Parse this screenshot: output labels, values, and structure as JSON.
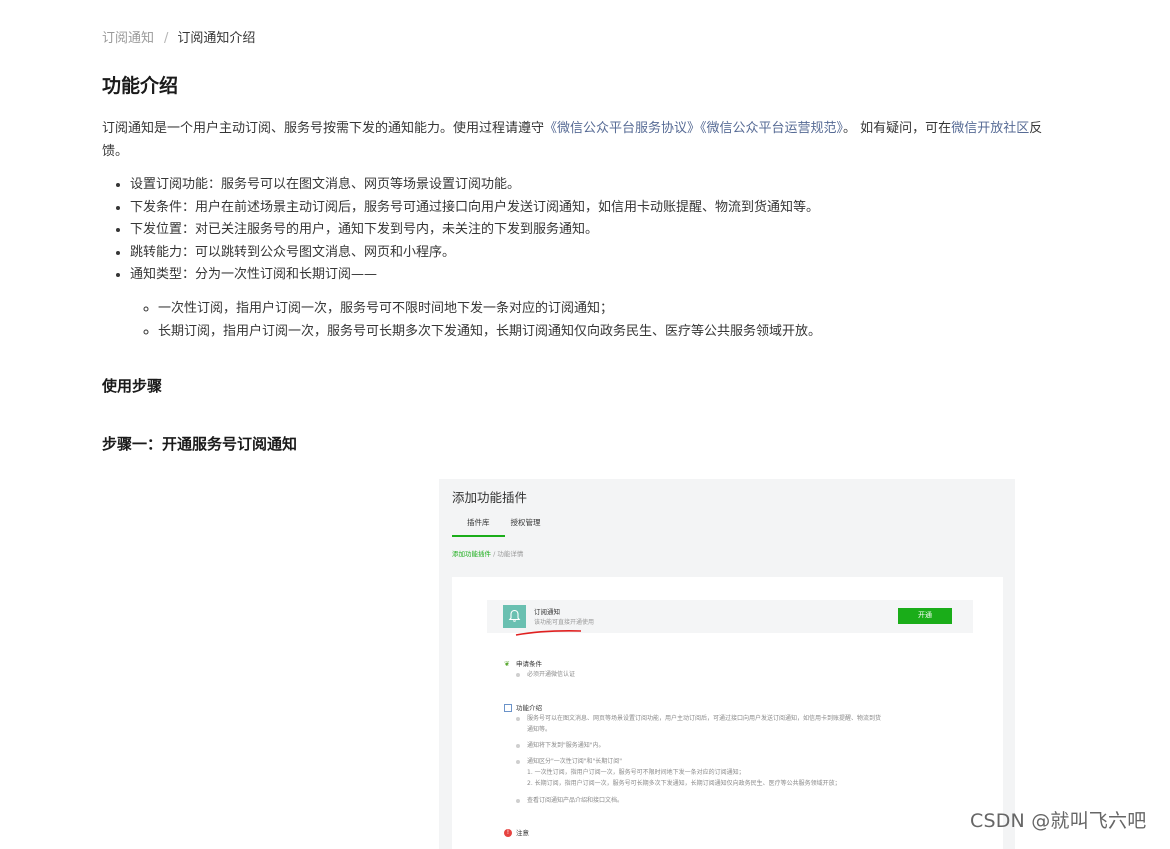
{
  "breadcrumb": {
    "parent": "订阅通知",
    "separator": "/",
    "current": "订阅通知介绍"
  },
  "title": "功能介绍",
  "intro": {
    "text1": "订阅通知是一个用户主动订阅、服务号按需下发的通知能力。使用过程请遵守",
    "link1": "《微信公众平台服务协议》",
    "link2": "《微信公众平台运营规范》",
    "text2": "。 如有疑问，可在",
    "link3": "微信开放社区",
    "text3": "反馈。"
  },
  "features": [
    "设置订阅功能：服务号可以在图文消息、网页等场景设置订阅功能。",
    "下发条件：用户在前述场景主动订阅后，服务号可通过接口向用户发送订阅通知，如信用卡动账提醒、物流到货通知等。",
    "下发位置：对已关注服务号的用户，通知下发到号内，未关注的下发到服务通知。",
    "跳转能力：可以跳转到公众号图文消息、网页和小程序。",
    "通知类型：分为一次性订阅和长期订阅——"
  ],
  "sub_features": [
    "一次性订阅，指用户订阅一次，服务号可不限时间地下发一条对应的订阅通知；",
    "长期订阅，指用户订阅一次，服务号可长期多次下发通知，长期订阅通知仅向政务民生、医疗等公共服务领域开放。"
  ],
  "usage_title": "使用步骤",
  "step1_title": "步骤一：开通服务号订阅通知",
  "screenshot": {
    "title": "添加功能插件",
    "tabs": [
      "插件库",
      "授权管理"
    ],
    "subcrumb_link": "添加功能插件",
    "subcrumb_rest": " / 功能详情",
    "plugin_name": "订阅通知",
    "plugin_desc": "该功能可直接开通使用",
    "open_button": "开通",
    "sections": {
      "apply_title": "申请条件",
      "apply_item": "必须开通微信认证",
      "intro_title": "功能介绍",
      "intro_item1": "服务号可以在图文消息、网页等场景设置订阅功能，用户主动订阅后，可通过接口向用户发送订阅通知，如信用卡到账提醒、物流到货",
      "intro_item1b": "通知等。",
      "intro_item2": "通知将下发到\"服务通知\"内。",
      "intro_item3": "通知区分\"一次性订阅\"和\"长期订阅\"",
      "intro_item3a": "1. 一次性订阅，指用户订阅一次，服务号可不限时间地下发一条对应的订阅通知；",
      "intro_item3b": "2. 长期订阅，指用户订阅一次，服务号可长期多次下发通知，长期订阅通知仅向政务民生、医疗等公共服务领域开放；",
      "intro_item4": "查看订阅通知产品介绍和接口文档。",
      "note_title": "注意"
    }
  },
  "watermark": "CSDN @就叫飞六吧",
  "colors": {
    "link": "#576b95",
    "accent_green": "#1aad19",
    "underline_red": "#e02020"
  }
}
